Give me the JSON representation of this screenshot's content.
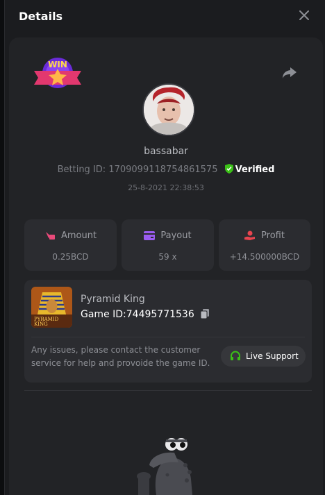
{
  "header": {
    "title": "Details",
    "close_icon": "close-icon"
  },
  "share_icon": "share-icon",
  "badge": {
    "text": "WIN"
  },
  "player": {
    "username": "bassabar"
  },
  "bet": {
    "betting_id_label": "Betting ID:",
    "betting_id": "1709099118754861575",
    "verified_label": "Verified",
    "datetime": "25-8-2021 22:38:53"
  },
  "stats": {
    "amount": {
      "label": "Amount",
      "value": "0.25BCD"
    },
    "payout": {
      "label": "Payout",
      "value": "59 x"
    },
    "profit": {
      "label": "Profit",
      "value": "+14.500000BCD"
    }
  },
  "game": {
    "name": "Pyramid King",
    "id_label": "Game ID:",
    "id_value": "74495771536",
    "thumb_text_1": "PYRAMID",
    "thumb_text_2": "KING",
    "issue_text": "Any issues, please contact the customer service for help and provoide the game ID.",
    "support_label": "Live Support"
  },
  "colors": {
    "modal_bg": "#1b1c1f",
    "card_bg": "#222326",
    "panel_bg": "#2b2c30",
    "verified_green": "#3bc117",
    "accent_pink": "#e94a7a",
    "accent_purple": "#9b5cf0",
    "accent_red": "#e8454f"
  }
}
